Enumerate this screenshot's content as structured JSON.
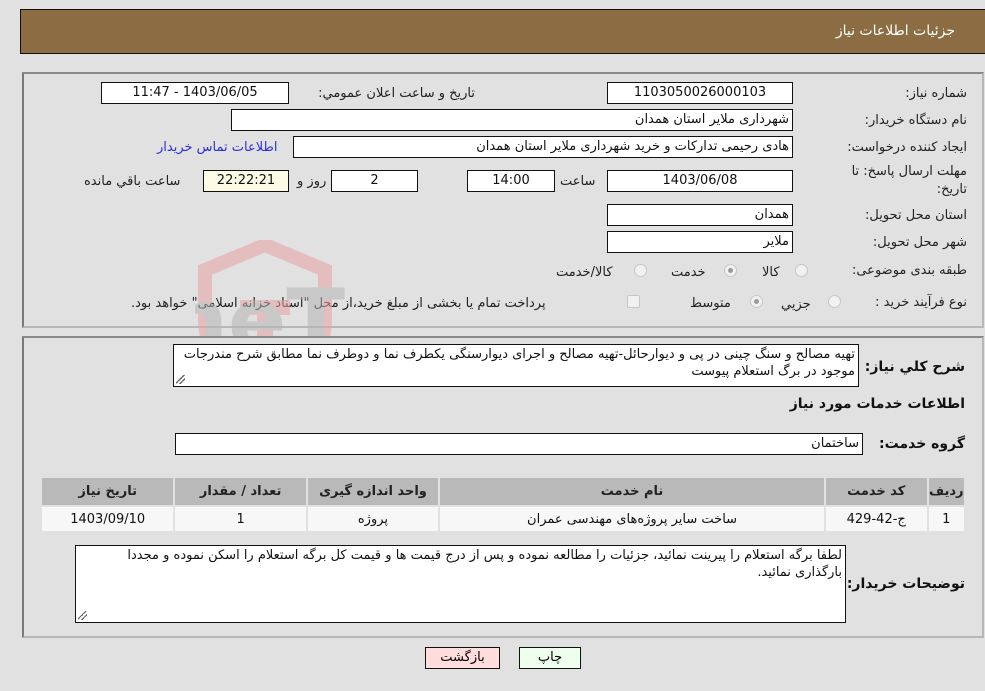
{
  "header": {
    "title": "جزئیات اطلاعات نیاز"
  },
  "form": {
    "need_number": {
      "label": "شماره نیاز:",
      "value": "1103050026000103"
    },
    "announce_datetime": {
      "label": "تاریخ و ساعت اعلان عمومي:",
      "value": "1403/06/05 - 11:47"
    },
    "buyer_org": {
      "label": "نام دستگاه خريدار:",
      "value": "شهرداری ملایر استان همدان"
    },
    "requester": {
      "label": "ایجاد کننده درخواست:",
      "value": "هادی رحیمی تدارکات و خرید شهرداری ملایر استان همدان"
    },
    "buyer_contact_link": "اطلاعات تماس خريدار",
    "deadline": {
      "label_line1": "مهلت ارسال پاسخ: تا",
      "label_line2": "تاریخ:",
      "date": "1403/06/08",
      "time_label": "ساعت",
      "time": "14:00",
      "days": "2",
      "days_label": "روز و",
      "remaining": "22:22:21",
      "remaining_label": "ساعت باقي مانده"
    },
    "province": {
      "label": "استان محل تحویل:",
      "value": "همدان"
    },
    "city": {
      "label": "شهر محل تحویل:",
      "value": "ملاير"
    },
    "category": {
      "label": "طبقه بندی موضوعی:",
      "options": [
        "کالا",
        "خدمت",
        "کالا/خدمت"
      ],
      "selected": "خدمت"
    },
    "purchase_type": {
      "label": "نوع فرآیند خرید :",
      "options": [
        "جزيي",
        "متوسط"
      ],
      "selected": "متوسط",
      "payment_note": "پرداخت تمام یا بخشی از مبلغ خرید،از محل \"اسناد خزانه اسلامی\" خواهد بود."
    }
  },
  "details": {
    "general_desc_label": "شرح کلي نياز:",
    "general_desc": "تهیه مصالح و سنگ چینی در پی و دیوارحائل-تهیه مصالح و اجرای دیوارسنگی یکطرف نما و دوطرف نما مطابق شرح مندرجات موجود در برگ استعلام پیوست",
    "services_title": "اطلاعات خدمات مورد نياز",
    "service_group_label": "گروه خدمت:",
    "service_group": "ساختمان",
    "table": {
      "headers": [
        "رديف",
        "کد خدمت",
        "نام خدمت",
        "واحد اندازه گیری",
        "تعداد / مقدار",
        "تاريخ نياز"
      ],
      "rows": [
        [
          "1",
          "ج-42-429",
          "ساخت سایر پروژه‌های مهندسی عمران",
          "پروژه",
          "1",
          "1403/09/10"
        ]
      ]
    },
    "buyer_notes_label": "توضيحات خريدار:",
    "buyer_notes": "لطفا برگه استعلام را پیرینت نمائید، جزئیات را مطالعه نموده و پس از درج قیمت ها و قیمت کل برگه استعلام را اسکن نموده و مجددا بارگذاری نمائید."
  },
  "buttons": {
    "print": "چاپ",
    "back": "بازگشت"
  },
  "watermark": {
    "text": "AriaTender.neT"
  }
}
